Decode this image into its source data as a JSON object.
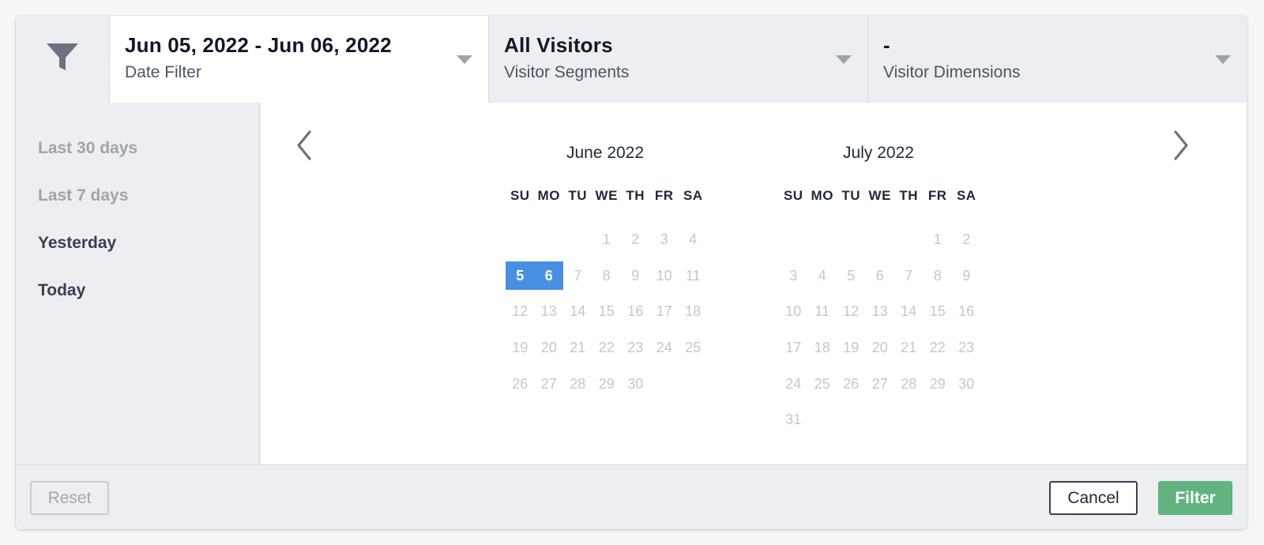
{
  "header": {
    "date_filter": {
      "value": "Jun 05, 2022 - Jun 06, 2022",
      "label": "Date Filter"
    },
    "segments": {
      "value": "All Visitors",
      "label": "Visitor Segments"
    },
    "dimensions": {
      "value": "-",
      "label": "Visitor Dimensions"
    }
  },
  "presets": [
    {
      "label": "Last 30 days",
      "muted": true
    },
    {
      "label": "Last 7 days",
      "muted": true
    },
    {
      "label": "Yesterday",
      "muted": false
    },
    {
      "label": "Today",
      "muted": false
    }
  ],
  "calendar": {
    "weekdays": [
      "SU",
      "MO",
      "TU",
      "WE",
      "TH",
      "FR",
      "SA"
    ],
    "months": [
      {
        "title": "June 2022",
        "weeks": [
          [
            "",
            "",
            "",
            "1",
            "2",
            "3",
            "4"
          ],
          [
            "5",
            "6",
            "7",
            "8",
            "9",
            "10",
            "11"
          ],
          [
            "12",
            "13",
            "14",
            "15",
            "16",
            "17",
            "18"
          ],
          [
            "19",
            "20",
            "21",
            "22",
            "23",
            "24",
            "25"
          ],
          [
            "26",
            "27",
            "28",
            "29",
            "30",
            "",
            ""
          ]
        ],
        "selected": [
          "5",
          "6"
        ]
      },
      {
        "title": "July 2022",
        "weeks": [
          [
            "",
            "",
            "",
            "",
            "",
            "1",
            "2"
          ],
          [
            "3",
            "4",
            "5",
            "6",
            "7",
            "8",
            "9"
          ],
          [
            "10",
            "11",
            "12",
            "13",
            "14",
            "15",
            "16"
          ],
          [
            "17",
            "18",
            "19",
            "20",
            "21",
            "22",
            "23"
          ],
          [
            "24",
            "25",
            "26",
            "27",
            "28",
            "29",
            "30"
          ],
          [
            "31",
            "",
            "",
            "",
            "",
            "",
            ""
          ]
        ],
        "selected": []
      }
    ]
  },
  "footer": {
    "reset_label": "Reset",
    "cancel_label": "Cancel",
    "filter_label": "Filter"
  },
  "colors": {
    "selected_day": "#4a90e2",
    "filter_button": "#63b380"
  }
}
